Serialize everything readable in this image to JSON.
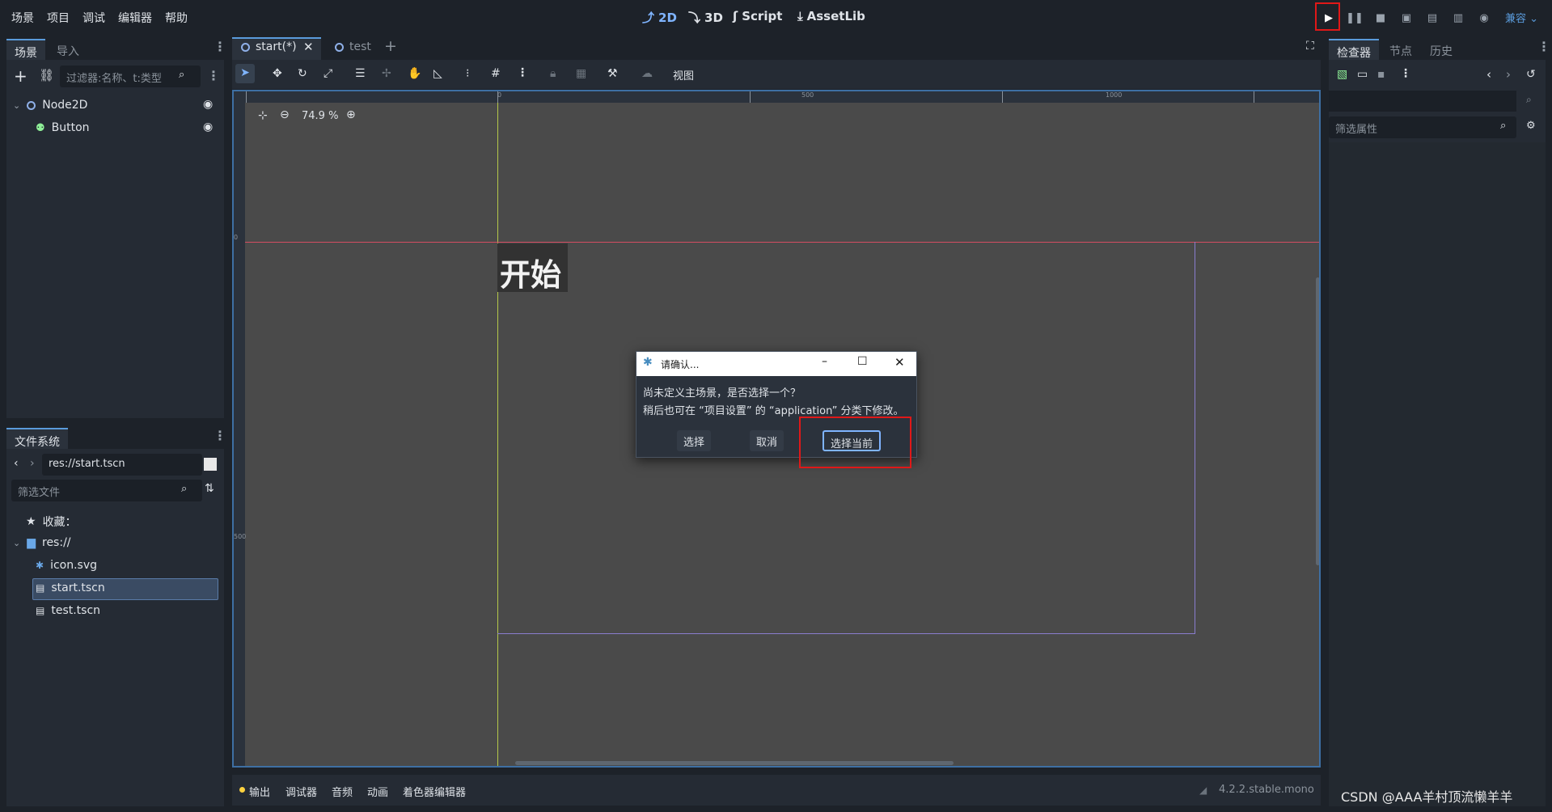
{
  "menu": [
    "场景",
    "项目",
    "调试",
    "编辑器",
    "帮助"
  ],
  "modes": [
    {
      "label": "2D",
      "icon": "2d-icon"
    },
    {
      "label": "3D",
      "icon": "3d-icon"
    },
    {
      "label": "Script",
      "icon": "script-icon"
    },
    {
      "label": "AssetLib",
      "icon": "assetlib-icon"
    }
  ],
  "renderer": "兼容",
  "scene_panel": {
    "tabs": [
      "场景",
      "导入"
    ],
    "filter_placeholder": "过滤器:名称、t:类型",
    "nodes": [
      {
        "name": "Node2D"
      },
      {
        "name": "Button"
      }
    ]
  },
  "filesystem": {
    "tab": "文件系统",
    "path": "res://start.tscn",
    "filter_placeholder": "筛选文件",
    "favorites": "收藏：",
    "root": "res://",
    "files": [
      "icon.svg",
      "start.tscn",
      "test.tscn"
    ]
  },
  "editor_tabs": [
    {
      "label": "start(*)"
    },
    {
      "label": "test"
    }
  ],
  "toolbar": {
    "view_label": "视图"
  },
  "viewport": {
    "zoom": "74.9 %",
    "ruler_labels": [
      "0",
      "500",
      "1000"
    ],
    "vruler_labels": [
      "0",
      "500"
    ],
    "button_text": "开始"
  },
  "dialog": {
    "title": "请确认...",
    "line1": "尚未定义主场景，是否选择一个？",
    "line2": "稍后也可在 “项目设置” 的 “application” 分类下修改。",
    "btn_select": "选择",
    "btn_cancel": "取消",
    "btn_select_current": "选择当前"
  },
  "inspector": {
    "tabs": [
      "检查器",
      "节点",
      "历史"
    ],
    "filter_placeholder": "筛选属性"
  },
  "bottom": {
    "tabs": [
      "输出",
      "调试器",
      "音频",
      "动画",
      "着色器编辑器"
    ],
    "version": "4.2.2.stable.mono"
  },
  "watermark": "CSDN @AAA羊村顶流懒羊羊",
  "colors": {
    "accent": "#5a9bdb",
    "highlight": "#e01818",
    "viewport": "#4a4a4a"
  }
}
